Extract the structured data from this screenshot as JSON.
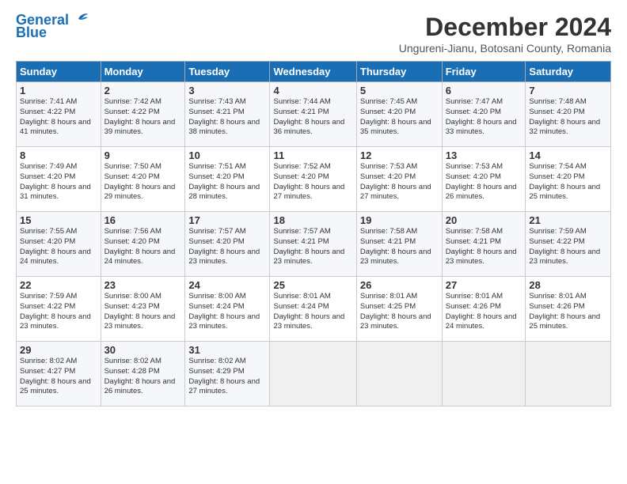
{
  "header": {
    "logo_line1": "General",
    "logo_line2": "Blue",
    "title": "December 2024",
    "location": "Ungureni-Jianu, Botosani County, Romania"
  },
  "weekdays": [
    "Sunday",
    "Monday",
    "Tuesday",
    "Wednesday",
    "Thursday",
    "Friday",
    "Saturday"
  ],
  "weeks": [
    [
      {
        "day": "1",
        "sunrise": "7:41 AM",
        "sunset": "4:22 PM",
        "daylight": "8 hours and 41 minutes."
      },
      {
        "day": "2",
        "sunrise": "7:42 AM",
        "sunset": "4:22 PM",
        "daylight": "8 hours and 39 minutes."
      },
      {
        "day": "3",
        "sunrise": "7:43 AM",
        "sunset": "4:21 PM",
        "daylight": "8 hours and 38 minutes."
      },
      {
        "day": "4",
        "sunrise": "7:44 AM",
        "sunset": "4:21 PM",
        "daylight": "8 hours and 36 minutes."
      },
      {
        "day": "5",
        "sunrise": "7:45 AM",
        "sunset": "4:20 PM",
        "daylight": "8 hours and 35 minutes."
      },
      {
        "day": "6",
        "sunrise": "7:47 AM",
        "sunset": "4:20 PM",
        "daylight": "8 hours and 33 minutes."
      },
      {
        "day": "7",
        "sunrise": "7:48 AM",
        "sunset": "4:20 PM",
        "daylight": "8 hours and 32 minutes."
      }
    ],
    [
      {
        "day": "8",
        "sunrise": "7:49 AM",
        "sunset": "4:20 PM",
        "daylight": "8 hours and 31 minutes."
      },
      {
        "day": "9",
        "sunrise": "7:50 AM",
        "sunset": "4:20 PM",
        "daylight": "8 hours and 29 minutes."
      },
      {
        "day": "10",
        "sunrise": "7:51 AM",
        "sunset": "4:20 PM",
        "daylight": "8 hours and 28 minutes."
      },
      {
        "day": "11",
        "sunrise": "7:52 AM",
        "sunset": "4:20 PM",
        "daylight": "8 hours and 27 minutes."
      },
      {
        "day": "12",
        "sunrise": "7:53 AM",
        "sunset": "4:20 PM",
        "daylight": "8 hours and 27 minutes."
      },
      {
        "day": "13",
        "sunrise": "7:53 AM",
        "sunset": "4:20 PM",
        "daylight": "8 hours and 26 minutes."
      },
      {
        "day": "14",
        "sunrise": "7:54 AM",
        "sunset": "4:20 PM",
        "daylight": "8 hours and 25 minutes."
      }
    ],
    [
      {
        "day": "15",
        "sunrise": "7:55 AM",
        "sunset": "4:20 PM",
        "daylight": "8 hours and 24 minutes."
      },
      {
        "day": "16",
        "sunrise": "7:56 AM",
        "sunset": "4:20 PM",
        "daylight": "8 hours and 24 minutes."
      },
      {
        "day": "17",
        "sunrise": "7:57 AM",
        "sunset": "4:20 PM",
        "daylight": "8 hours and 23 minutes."
      },
      {
        "day": "18",
        "sunrise": "7:57 AM",
        "sunset": "4:21 PM",
        "daylight": "8 hours and 23 minutes."
      },
      {
        "day": "19",
        "sunrise": "7:58 AM",
        "sunset": "4:21 PM",
        "daylight": "8 hours and 23 minutes."
      },
      {
        "day": "20",
        "sunrise": "7:58 AM",
        "sunset": "4:21 PM",
        "daylight": "8 hours and 23 minutes."
      },
      {
        "day": "21",
        "sunrise": "7:59 AM",
        "sunset": "4:22 PM",
        "daylight": "8 hours and 23 minutes."
      }
    ],
    [
      {
        "day": "22",
        "sunrise": "7:59 AM",
        "sunset": "4:22 PM",
        "daylight": "8 hours and 23 minutes."
      },
      {
        "day": "23",
        "sunrise": "8:00 AM",
        "sunset": "4:23 PM",
        "daylight": "8 hours and 23 minutes."
      },
      {
        "day": "24",
        "sunrise": "8:00 AM",
        "sunset": "4:24 PM",
        "daylight": "8 hours and 23 minutes."
      },
      {
        "day": "25",
        "sunrise": "8:01 AM",
        "sunset": "4:24 PM",
        "daylight": "8 hours and 23 minutes."
      },
      {
        "day": "26",
        "sunrise": "8:01 AM",
        "sunset": "4:25 PM",
        "daylight": "8 hours and 23 minutes."
      },
      {
        "day": "27",
        "sunrise": "8:01 AM",
        "sunset": "4:26 PM",
        "daylight": "8 hours and 24 minutes."
      },
      {
        "day": "28",
        "sunrise": "8:01 AM",
        "sunset": "4:26 PM",
        "daylight": "8 hours and 25 minutes."
      }
    ],
    [
      {
        "day": "29",
        "sunrise": "8:02 AM",
        "sunset": "4:27 PM",
        "daylight": "8 hours and 25 minutes."
      },
      {
        "day": "30",
        "sunrise": "8:02 AM",
        "sunset": "4:28 PM",
        "daylight": "8 hours and 26 minutes."
      },
      {
        "day": "31",
        "sunrise": "8:02 AM",
        "sunset": "4:29 PM",
        "daylight": "8 hours and 27 minutes."
      },
      null,
      null,
      null,
      null
    ]
  ]
}
